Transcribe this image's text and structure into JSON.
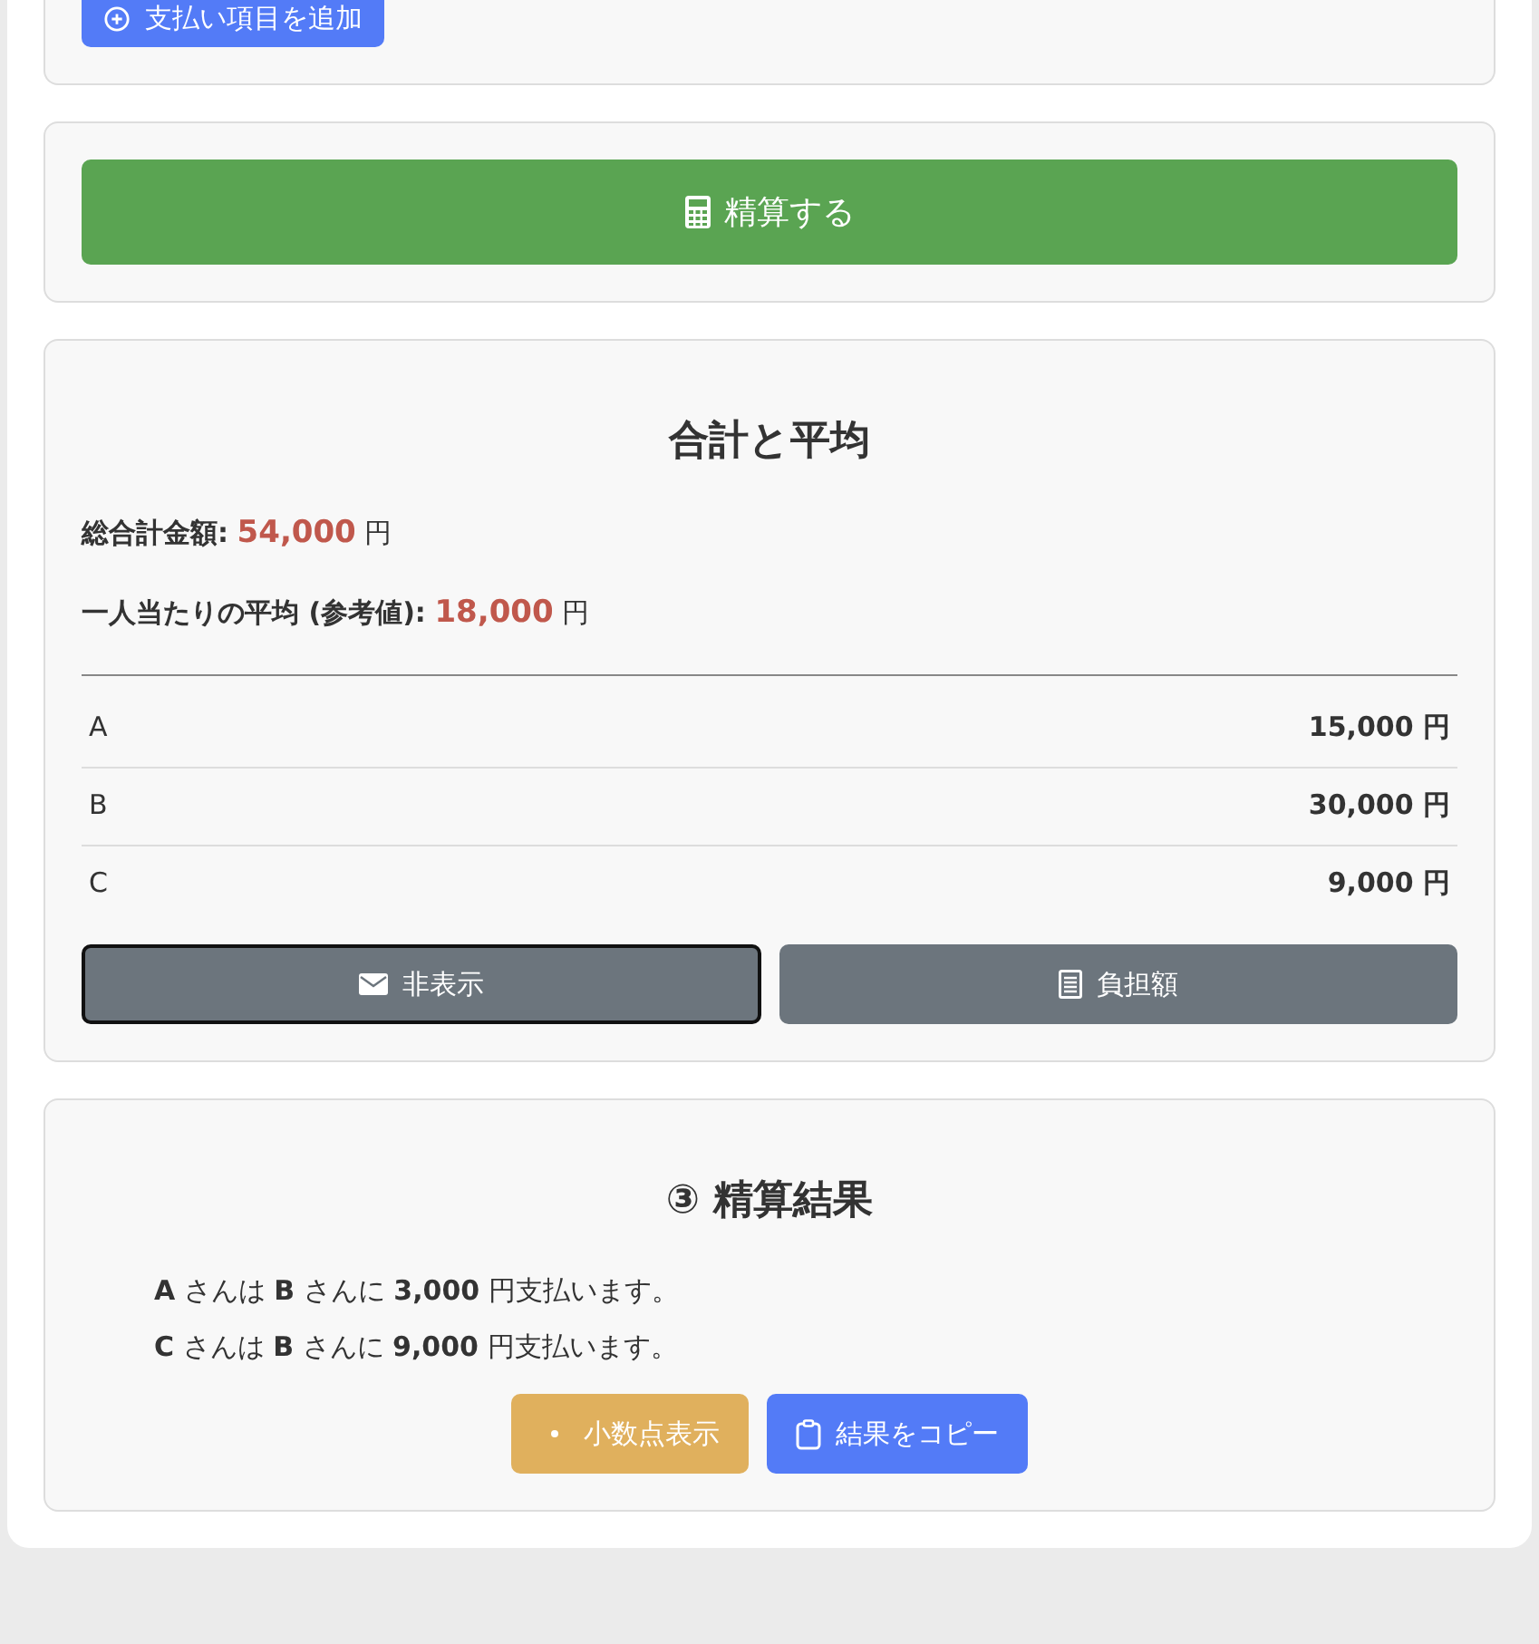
{
  "add_payment_button": {
    "label": "支払い項目を追加"
  },
  "settle_button": {
    "label": "精算する"
  },
  "summary": {
    "title": "合計と平均",
    "total": {
      "label": "総合計金額:",
      "amount": "54,000",
      "unit": "円"
    },
    "average": {
      "label": "一人当たりの平均 (参考値):",
      "amount": "18,000",
      "unit": "円"
    },
    "rows": [
      {
        "name": "A",
        "amount": "15,000 円"
      },
      {
        "name": "B",
        "amount": "30,000 円"
      },
      {
        "name": "C",
        "amount": "9,000 円"
      }
    ],
    "buttons": [
      {
        "label": "非表示",
        "kind": "envelope",
        "focused": true
      },
      {
        "label": "負担額",
        "kind": "list",
        "focused": false
      }
    ]
  },
  "result": {
    "title": "③ 精算結果",
    "lines": [
      "**A** さんは **B** さんに **3,000** 円支払います。",
      "**C** さんは **B** さんに **9,000** 円支払います。"
    ],
    "buttons": [
      {
        "label": "小数点表示",
        "kind": "decimal"
      },
      {
        "label": "結果をコピー",
        "kind": "copy"
      }
    ]
  }
}
